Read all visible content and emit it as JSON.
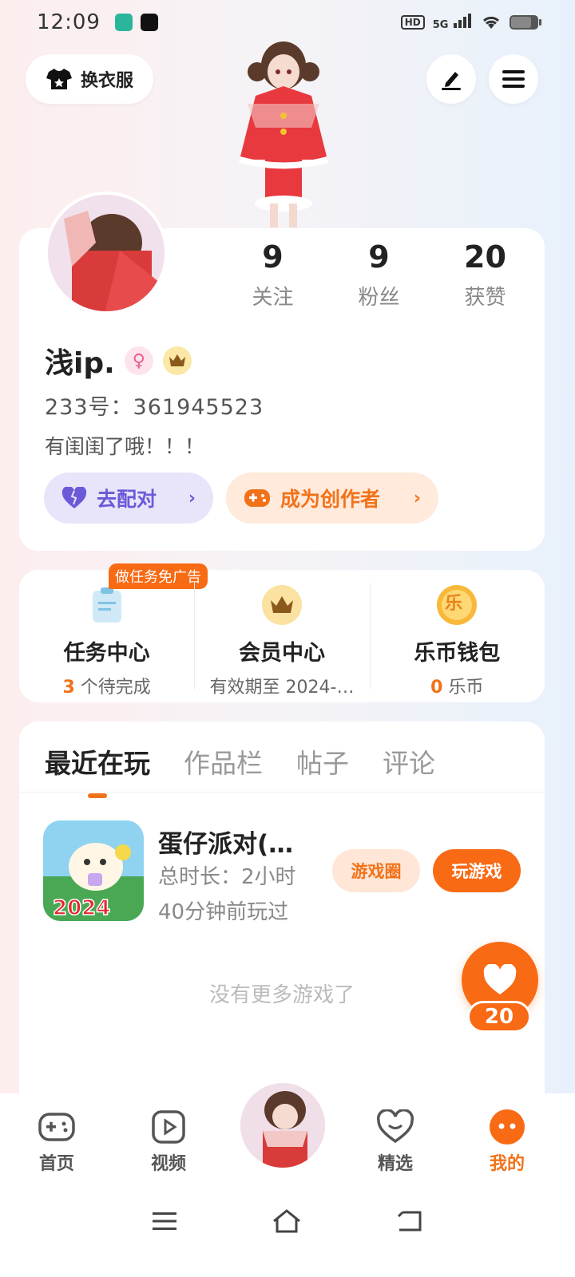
{
  "status_bar": {
    "time": "12:09",
    "hd": "HD",
    "network": "5G"
  },
  "header": {
    "outfit_label": "换衣服"
  },
  "profile": {
    "stats": [
      {
        "value": "9",
        "label": "关注"
      },
      {
        "value": "9",
        "label": "粉丝"
      },
      {
        "value": "20",
        "label": "获赞"
      }
    ],
    "name": "浅ip.",
    "gender_symbol": "♀",
    "uid": "233号：361945523",
    "bio": "有闺闺了哦！！！",
    "match_label": "去配对",
    "creator_label": "成为创作者"
  },
  "centers": {
    "task": {
      "tag": "做任务免广告",
      "title": "任务中心",
      "count": "3",
      "suffix": " 个待完成"
    },
    "vip": {
      "title": "会员中心",
      "subtitle": "有效期至 2024-…"
    },
    "wallet": {
      "icon_char": "乐",
      "title": "乐币钱包",
      "count": "0",
      "suffix": " 乐币"
    }
  },
  "content": {
    "tabs": [
      "最近在玩",
      "作品栏",
      "帖子",
      "评论"
    ],
    "game": {
      "name": "蛋仔派对(…",
      "duration": "总时长：2小时",
      "last_played": "40分钟前玩过",
      "icon_text": "2024",
      "circle_label": "游戏圈",
      "play_label": "玩游戏"
    },
    "empty_text": "没有更多游戏了"
  },
  "like_float": {
    "count": "20"
  },
  "bottom_nav": {
    "home": "首页",
    "video": "视频",
    "pick": "精选",
    "mine": "我的"
  },
  "colors": {
    "accent": "#f27219",
    "accent_solid": "#f86a14",
    "match_bg": "#e8e5fb",
    "match_text": "#6a5ad8"
  }
}
